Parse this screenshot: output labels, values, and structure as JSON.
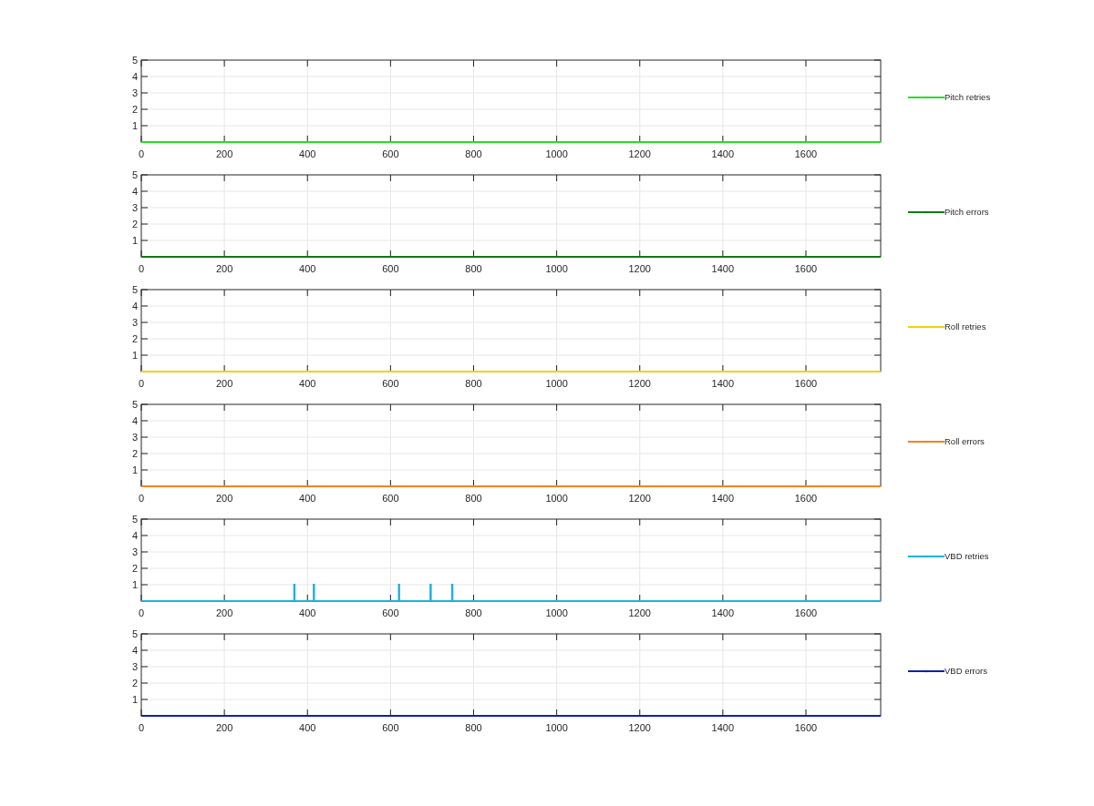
{
  "charts": [
    {
      "chart_data": {
        "type": "line",
        "x": [
          0,
          1780
        ],
        "series": [
          {
            "name": "Pitch retries",
            "color": "#22e022",
            "values": [
              0,
              0
            ]
          }
        ],
        "grid": true,
        "xlim": [
          0,
          1780
        ],
        "ylim": [
          0,
          5
        ],
        "xticks": [
          0,
          200,
          400,
          600,
          800,
          1000,
          1200,
          1400,
          1600
        ],
        "yticks": [
          1,
          2,
          3,
          4,
          5
        ]
      }
    },
    {
      "chart_data": {
        "type": "line",
        "x": [
          0,
          1780
        ],
        "series": [
          {
            "name": "Pitch errors",
            "color": "#137a13",
            "values": [
              0,
              0
            ]
          }
        ],
        "grid": true,
        "xlim": [
          0,
          1780
        ],
        "ylim": [
          0,
          5
        ],
        "xticks": [
          0,
          200,
          400,
          600,
          800,
          1000,
          1200,
          1400,
          1600
        ],
        "yticks": [
          1,
          2,
          3,
          4,
          5
        ]
      }
    },
    {
      "chart_data": {
        "type": "line",
        "x": [
          0,
          1780
        ],
        "series": [
          {
            "name": "Roll retries",
            "color": "#f2cf10",
            "values": [
              0,
              0
            ]
          }
        ],
        "grid": true,
        "xlim": [
          0,
          1780
        ],
        "ylim": [
          0,
          5
        ],
        "xticks": [
          0,
          200,
          400,
          600,
          800,
          1000,
          1200,
          1400,
          1600
        ],
        "yticks": [
          1,
          2,
          3,
          4,
          5
        ]
      }
    },
    {
      "chart_data": {
        "type": "line",
        "x": [
          0,
          1780
        ],
        "series": [
          {
            "name": "Roll errors",
            "color": "#f08422",
            "values": [
              0,
              0
            ]
          }
        ],
        "grid": true,
        "xlim": [
          0,
          1780
        ],
        "ylim": [
          0,
          5
        ],
        "xticks": [
          0,
          200,
          400,
          600,
          800,
          1000,
          1200,
          1400,
          1600
        ],
        "yticks": [
          1,
          2,
          3,
          4,
          5
        ]
      }
    },
    {
      "chart_data": {
        "type": "line",
        "x": [
          0,
          368,
          368,
          369,
          369,
          415,
          415,
          416,
          416,
          620,
          620,
          621,
          621,
          696,
          696,
          697,
          697,
          748,
          748,
          749,
          749,
          1780
        ],
        "series": [
          {
            "name": "VBD retries",
            "color": "#1fb0e0",
            "values": [
              0,
              0,
              1,
              1,
              0,
              0,
              1,
              1,
              0,
              0,
              1,
              1,
              0,
              0,
              1,
              1,
              0,
              0,
              1,
              1,
              0,
              0
            ]
          }
        ],
        "grid": true,
        "xlim": [
          0,
          1780
        ],
        "ylim": [
          0,
          5
        ],
        "xticks": [
          0,
          200,
          400,
          600,
          800,
          1000,
          1200,
          1400,
          1600
        ],
        "yticks": [
          1,
          2,
          3,
          4,
          5
        ]
      }
    },
    {
      "chart_data": {
        "type": "line",
        "x": [
          0,
          1780
        ],
        "series": [
          {
            "name": "VBD errors",
            "color": "#1020a8",
            "values": [
              0,
              0
            ]
          }
        ],
        "grid": true,
        "xlim": [
          0,
          1780
        ],
        "ylim": [
          0,
          5
        ],
        "xticks": [
          0,
          200,
          400,
          600,
          800,
          1000,
          1200,
          1400,
          1600
        ],
        "yticks": [
          1,
          2,
          3,
          4,
          5
        ]
      }
    }
  ]
}
